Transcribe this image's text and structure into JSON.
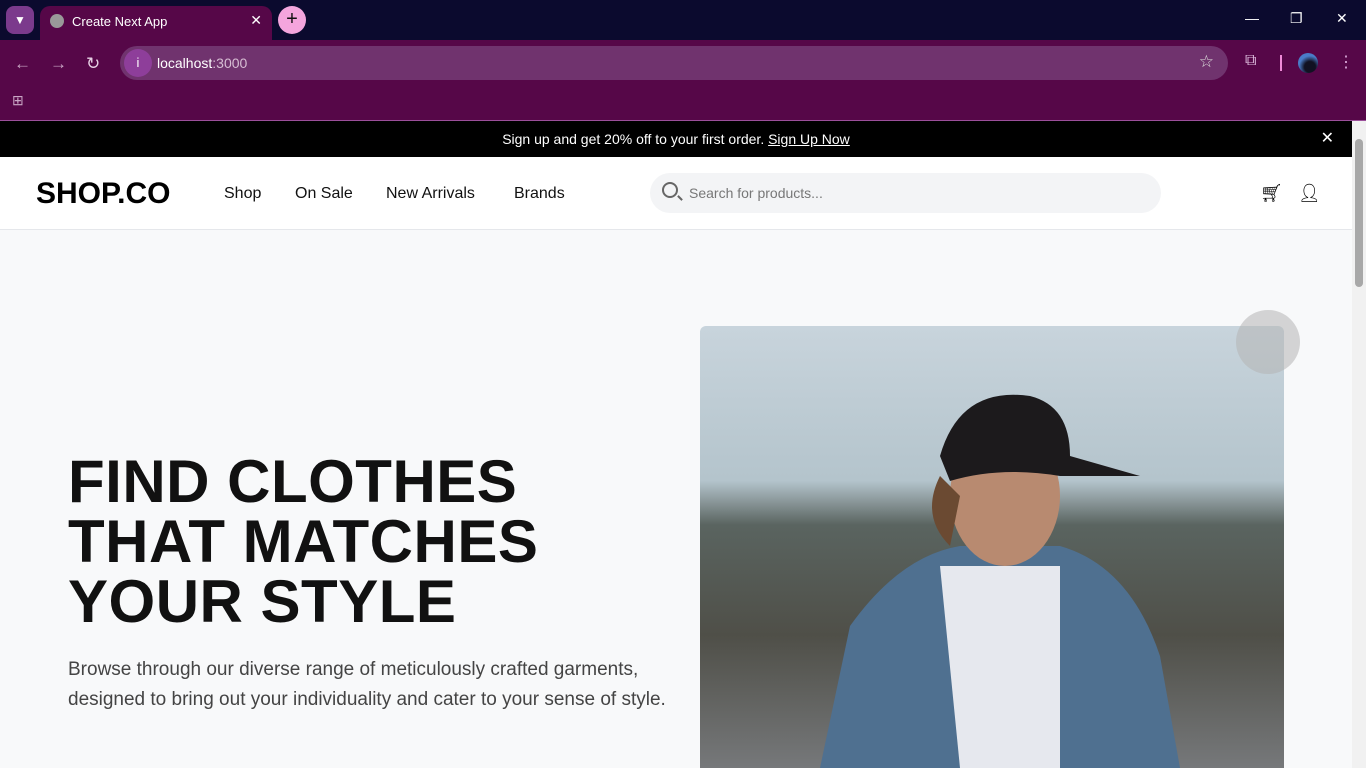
{
  "browser": {
    "tab_title": "Create Next App",
    "url_host": "localhost",
    "url_port": ":3000"
  },
  "promo": {
    "text": "Sign up and get 20% off to your first order.",
    "link": "Sign Up Now"
  },
  "header": {
    "logo": "SHOP.CO",
    "nav": [
      "Shop",
      "On Sale",
      "New Arrivals",
      "Brands"
    ],
    "search_placeholder": "Search for products..."
  },
  "hero": {
    "title_lines": [
      "FIND CLOTHES",
      "THAT MATCHES",
      "YOUR STYLE"
    ],
    "description": "Browse through our diverse range of meticulously crafted garments, designed to bring out your individuality and cater to your sense of style."
  }
}
